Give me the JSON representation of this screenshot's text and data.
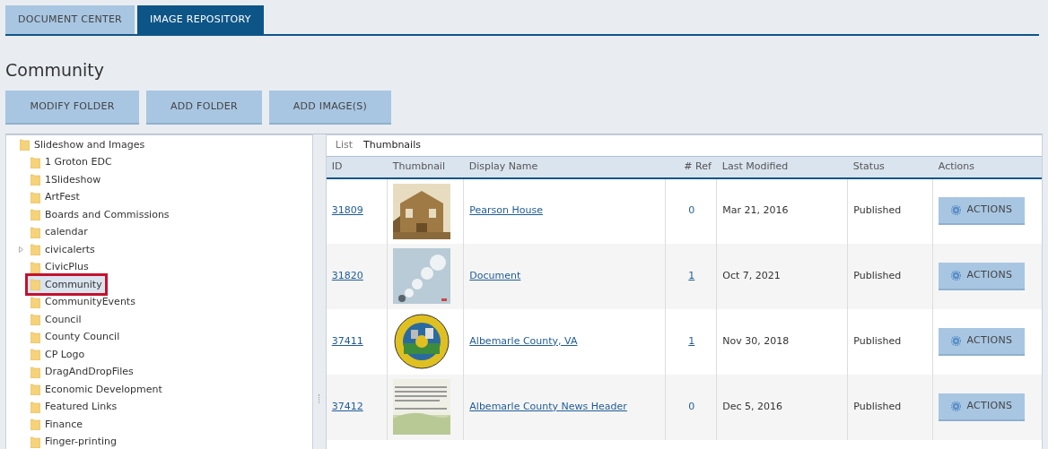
{
  "tabs": [
    {
      "label": "DOCUMENT CENTER",
      "selected": false
    },
    {
      "label": "IMAGE REPOSITORY",
      "selected": true
    }
  ],
  "title": "Community",
  "buttons": [
    "MODIFY FOLDER",
    "ADD FOLDER",
    "ADD IMAGE(S)"
  ],
  "tree": {
    "label": "Slideshow and Images",
    "children": [
      {
        "label": "1 Groton EDC",
        "selected": false
      },
      {
        "label": "1Slideshow",
        "selected": false
      },
      {
        "label": "ArtFest",
        "selected": false
      },
      {
        "label": "Boards and Commissions",
        "selected": false
      },
      {
        "label": "calendar",
        "selected": false
      },
      {
        "label": "civicalerts",
        "selected": false,
        "expanded": false
      },
      {
        "label": "CivicPlus",
        "selected": false
      },
      {
        "label": "Community",
        "selected": true
      },
      {
        "label": "CommunityEvents",
        "selected": false
      },
      {
        "label": "Council",
        "selected": false
      },
      {
        "label": "County Council",
        "selected": false
      },
      {
        "label": "CP Logo",
        "selected": false
      },
      {
        "label": "DragAndDropFiles",
        "selected": false
      },
      {
        "label": "Economic Development",
        "selected": false
      },
      {
        "label": "Featured Links",
        "selected": false
      },
      {
        "label": "Finance",
        "selected": false
      },
      {
        "label": "Finger-printing",
        "selected": false
      }
    ]
  },
  "view_tabs": [
    {
      "label": "List",
      "selected": false
    },
    {
      "label": "Thumbnails",
      "selected": true
    }
  ],
  "table": {
    "columns": [
      "ID",
      "Thumbnail",
      "Display Name",
      "# Ref",
      "Last Modified",
      "Status",
      "Actions"
    ],
    "rows": [
      {
        "id": "31809",
        "name": "Pearson House",
        "ref": "0",
        "ref_linked": false,
        "modified": "Mar 21, 2016",
        "status": "Published",
        "action": "ACTIONS"
      },
      {
        "id": "31820",
        "name": "Document",
        "ref": "1",
        "ref_linked": true,
        "modified": "Oct 7, 2021",
        "status": "Published",
        "action": "ACTIONS"
      },
      {
        "id": "37411",
        "name": "Albemarle County, VA",
        "ref": "1",
        "ref_linked": true,
        "modified": "Nov 30, 2018",
        "status": "Published",
        "action": "ACTIONS"
      },
      {
        "id": "37412",
        "name": "Albemarle County News Header",
        "ref": "0",
        "ref_linked": false,
        "modified": "Dec 5, 2016",
        "status": "Published",
        "action": "ACTIONS"
      }
    ]
  }
}
